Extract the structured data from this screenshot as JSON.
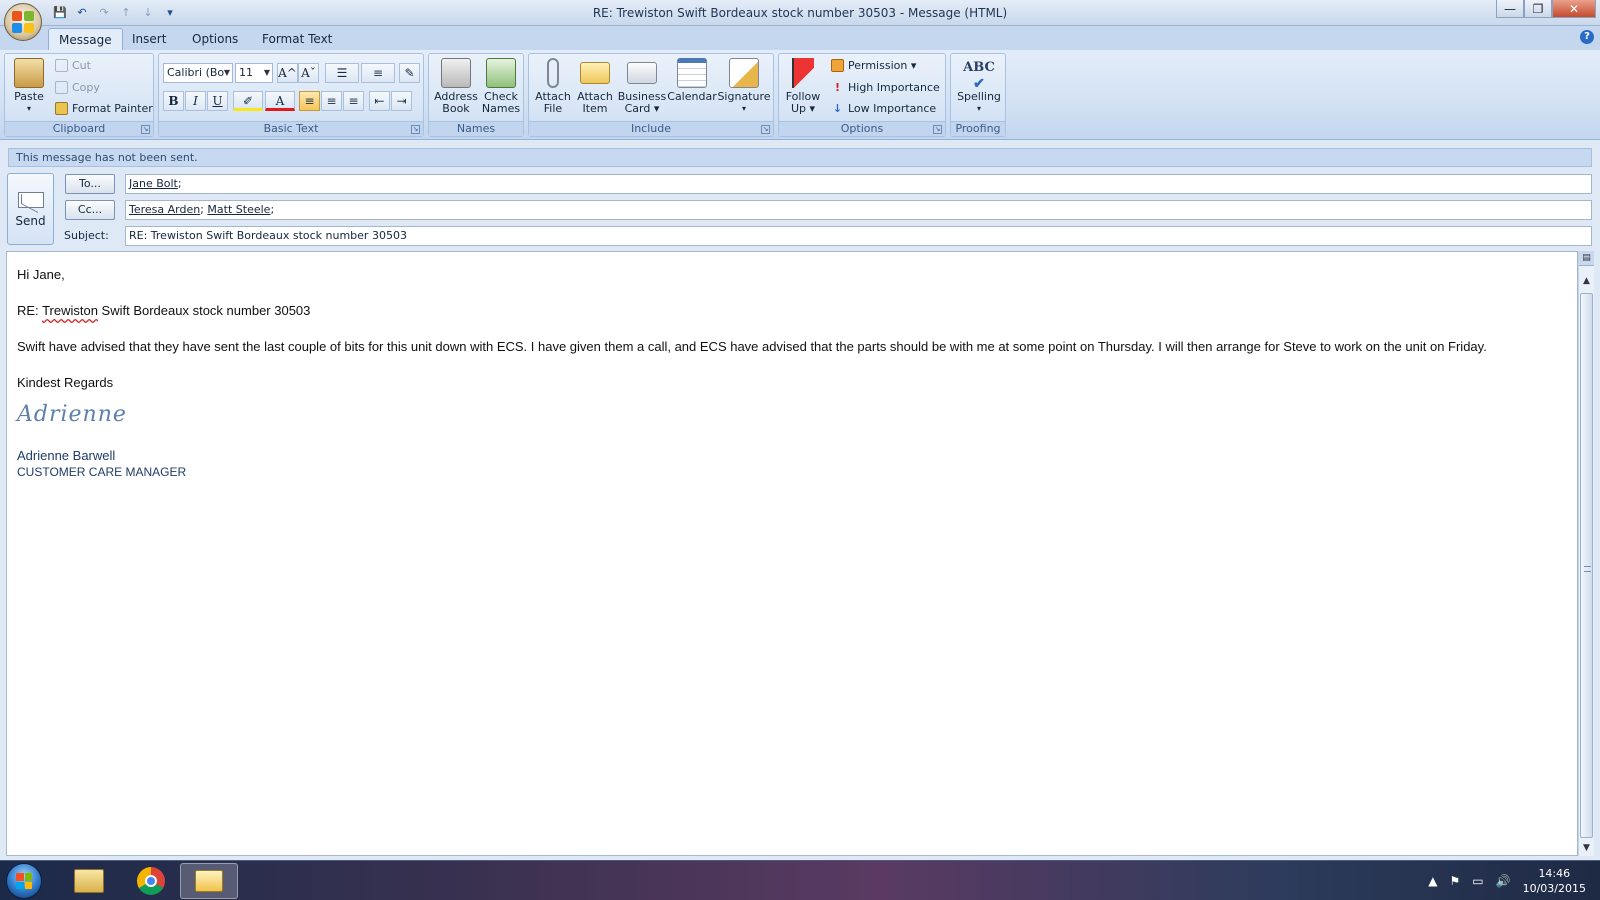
{
  "window": {
    "title": "RE: Trewiston Swift Bordeaux stock number  30503 - Message (HTML)",
    "minimize": "—",
    "restore": "❐",
    "close": "✕"
  },
  "qat": [
    "💾",
    "↶",
    "↷",
    "↑",
    "↓",
    "▾"
  ],
  "tabs": [
    {
      "label": "Message",
      "active": true
    },
    {
      "label": "Insert",
      "active": false
    },
    {
      "label": "Options",
      "active": false
    },
    {
      "label": "Format Text",
      "active": false
    }
  ],
  "help": "?",
  "ribbon": {
    "clipboard": {
      "label": "Clipboard",
      "paste": "Paste",
      "paste_arrow": "▾",
      "cut": "Cut",
      "copy": "Copy",
      "format_painter": "Format Painter"
    },
    "basic_text": {
      "label": "Basic Text",
      "font": "Calibri (Bo",
      "size": "11",
      "grow": "A^",
      "shrink": "Aˇ",
      "bold": "B",
      "italic": "I",
      "underline": "U"
    },
    "names": {
      "label": "Names",
      "address_book": [
        "Address",
        "Book"
      ],
      "check_names": [
        "Check",
        "Names"
      ]
    },
    "include": {
      "label": "Include",
      "attach_file": [
        "Attach",
        "File"
      ],
      "attach_item": [
        "Attach",
        "Item"
      ],
      "business_card": [
        "Business",
        "Card ▾"
      ],
      "calendar": "Calendar",
      "signature": "Signature",
      "signature_arrow": "▾"
    },
    "options": {
      "label": "Options",
      "follow_up": [
        "Follow",
        "Up ▾"
      ],
      "permission": "Permission ▾",
      "high_importance": "High Importance",
      "low_importance": "Low Importance"
    },
    "proofing": {
      "label": "Proofing",
      "spelling": "Spelling",
      "spelling_arrow": "▾",
      "abc": "ABC"
    }
  },
  "notice": "This message has not been sent.",
  "send_label": "Send",
  "to_button": "To...",
  "cc_button": "Cc...",
  "subject_label": "Subject:",
  "to_recipients": [
    "Jane Bolt"
  ],
  "cc_recipients": [
    "Teresa Arden",
    "Matt Steele"
  ],
  "subject": "RE: Trewiston Swift Bordeaux stock number  30503",
  "body": {
    "greeting": "Hi Jane,",
    "re_prefix": "RE: ",
    "re_word": "Trewiston",
    "re_rest": " Swift Bordeaux stock number  30503",
    "paragraph": "Swift have advised that they have sent the last couple of bits for this unit down with ECS.  I have given them a call, and ECS have advised that  the parts should be with me at some point on Thursday.   I will then arrange for Steve to work on the unit on Friday.",
    "closing": "Kindest Regards",
    "signature_script": "Adrienne",
    "signature_name": "Adrienne Barwell",
    "signature_title": "CUSTOMER CARE MANAGER"
  },
  "scrollbar": {
    "up": "▲",
    "down": "▼"
  },
  "taskbar": {
    "time": "14:46",
    "date": "10/03/2015",
    "tray_icons": [
      "▲",
      "⚑",
      "▭",
      "🔊"
    ]
  },
  "colors": {
    "accent": "#2a6bc4",
    "ribbon_bg": "#d6e4f5",
    "signature_blue": "#1f3c6b"
  }
}
